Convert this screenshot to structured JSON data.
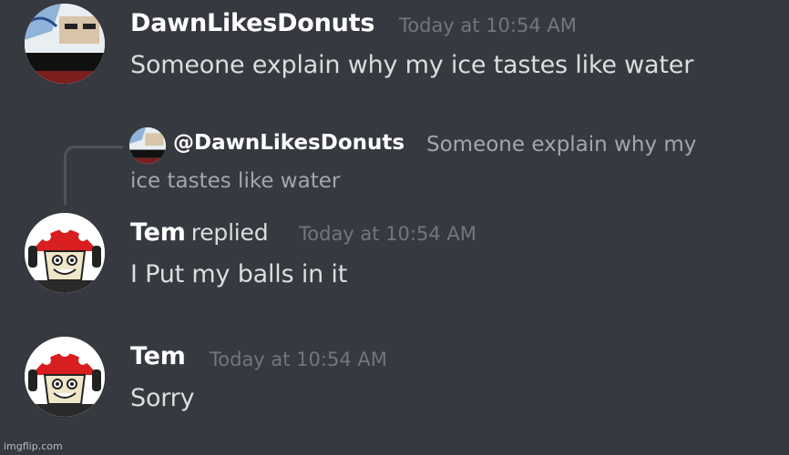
{
  "messages": [
    {
      "username": "DawnLikesDonuts",
      "timestamp": "Today at 10:54 AM",
      "content": "Someone explain why my ice tastes like water"
    },
    {
      "reply_mention": "@DawnLikesDonuts",
      "reply_text_line1": "Someone explain why my",
      "reply_text_line2": "ice tastes like water",
      "username": "Tem",
      "replied_label": "replied",
      "timestamp": "Today at 10:54 AM",
      "content": "I Put my balls in it"
    },
    {
      "username": "Tem",
      "timestamp": "Today at 10:54 AM",
      "content": "Sorry"
    }
  ],
  "watermark": "imgflip.com",
  "colors": {
    "background": "#36393f",
    "username": "#ffffff",
    "timestamp": "#72767d",
    "content": "#dcddde",
    "reply_text": "#a3a6aa"
  },
  "icons": [
    "dawn-avatar",
    "tem-avatar"
  ]
}
